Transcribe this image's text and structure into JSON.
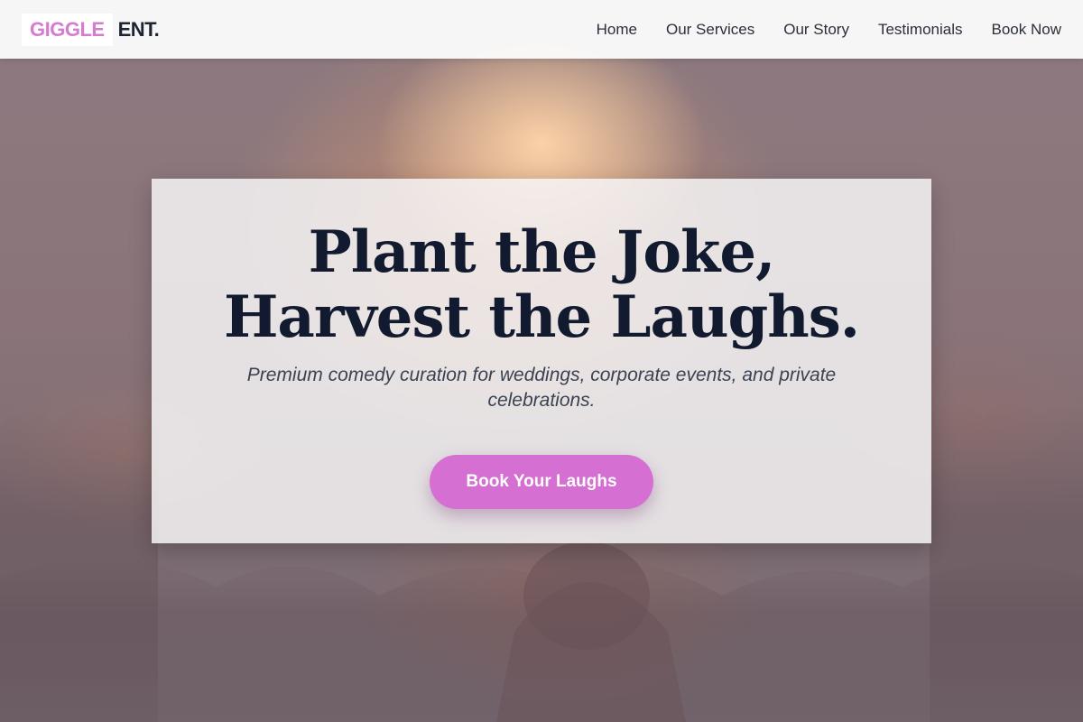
{
  "brand": {
    "name_highlight": "GIGGLE",
    "name_rest": "ENT.",
    "accent_color": "#d67bd0"
  },
  "nav": {
    "items": [
      {
        "label": "Home"
      },
      {
        "label": "Our Services"
      },
      {
        "label": "Our Story"
      },
      {
        "label": "Testimonials"
      },
      {
        "label": "Book Now"
      }
    ]
  },
  "hero": {
    "headline": "Plant the Joke, Harvest the Laughs.",
    "subheadline": "Premium comedy curation for weddings, corporate events, and private celebrations.",
    "cta_label": "Book Your Laughs",
    "cta_color": "#d66fd2",
    "background_image": "concert-crowd-photo"
  }
}
